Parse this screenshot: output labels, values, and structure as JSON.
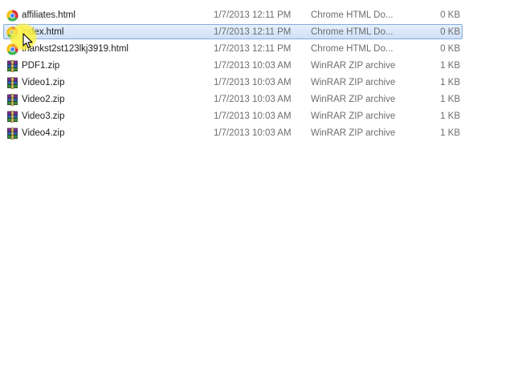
{
  "files": [
    {
      "name": "affiliates.html",
      "date": "1/7/2013 12:11 PM",
      "type": "Chrome HTML Do...",
      "size": "0 KB",
      "icon": "chrome-html-icon",
      "selected": false
    },
    {
      "name": "index.html",
      "date": "1/7/2013 12:11 PM",
      "type": "Chrome HTML Do...",
      "size": "0 KB",
      "icon": "chrome-html-icon",
      "selected": true
    },
    {
      "name": "thankst2st123lkj3919.html",
      "date": "1/7/2013 12:11 PM",
      "type": "Chrome HTML Do...",
      "size": "0 KB",
      "icon": "chrome-html-icon",
      "selected": false
    },
    {
      "name": "PDF1.zip",
      "date": "1/7/2013 10:03 AM",
      "type": "WinRAR ZIP archive",
      "size": "1 KB",
      "icon": "winrar-zip-icon",
      "selected": false
    },
    {
      "name": "Video1.zip",
      "date": "1/7/2013 10:03 AM",
      "type": "WinRAR ZIP archive",
      "size": "1 KB",
      "icon": "winrar-zip-icon",
      "selected": false
    },
    {
      "name": "Video2.zip",
      "date": "1/7/2013 10:03 AM",
      "type": "WinRAR ZIP archive",
      "size": "1 KB",
      "icon": "winrar-zip-icon",
      "selected": false
    },
    {
      "name": "Video3.zip",
      "date": "1/7/2013 10:03 AM",
      "type": "WinRAR ZIP archive",
      "size": "1 KB",
      "icon": "winrar-zip-icon",
      "selected": false
    },
    {
      "name": "Video4.zip",
      "date": "1/7/2013 10:03 AM",
      "type": "WinRAR ZIP archive",
      "size": "1 KB",
      "icon": "winrar-zip-icon",
      "selected": false
    }
  ],
  "colors": {
    "selection_fill": "#cfe0f7",
    "selection_border": "#84acdd",
    "cursor_highlight": "#fff450"
  }
}
